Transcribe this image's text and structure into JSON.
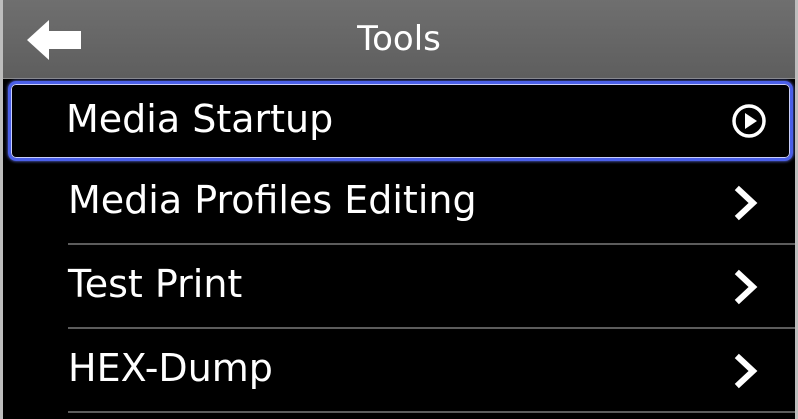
{
  "header": {
    "title": "Tools",
    "back_icon": "back-arrow-icon"
  },
  "menu": {
    "items": [
      {
        "label": "Media Startup",
        "icon": "play-circle-icon",
        "selected": true
      },
      {
        "label": "Media Profiles Editing",
        "icon": "chevron-right-icon",
        "selected": false
      },
      {
        "label": "Test Print",
        "icon": "chevron-right-icon",
        "selected": false
      },
      {
        "label": "HEX-Dump",
        "icon": "chevron-right-icon",
        "selected": false
      }
    ]
  },
  "colors": {
    "header_bg": "#666666",
    "background": "#000000",
    "selection_border": "#4a5fe8",
    "text": "#ffffff"
  }
}
